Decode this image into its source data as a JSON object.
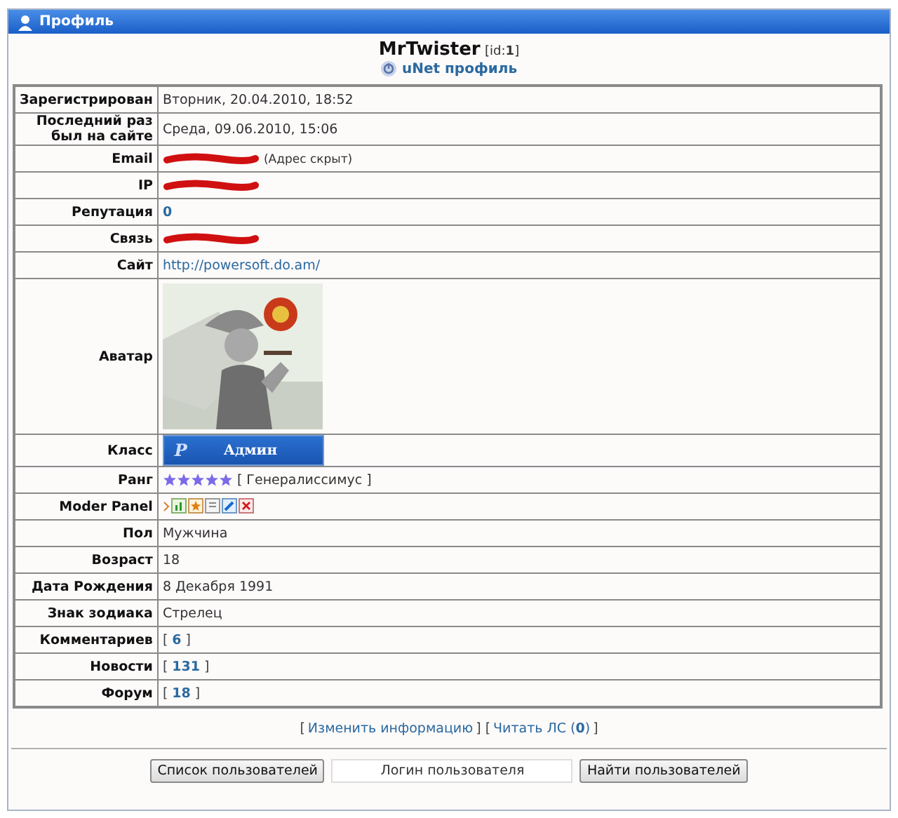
{
  "window": {
    "title": "Профиль"
  },
  "header": {
    "name": "MrTwister",
    "id_prefix": "[id:",
    "id": "1",
    "id_suffix": "]",
    "unet": "uNet профиль"
  },
  "rows": [
    {
      "kind": "text",
      "label": "Зарегистрирован",
      "value": "Вторник, 20.04.2010, 18:52"
    },
    {
      "kind": "text",
      "label": "Последний раз был на сайте",
      "value": "Среда, 09.06.2010, 15:06"
    },
    {
      "kind": "redacted",
      "label": "Email",
      "note": "(Адрес скрыт)"
    },
    {
      "kind": "redacted",
      "label": "IP"
    },
    {
      "kind": "boldlink",
      "label": "Репутация",
      "value": "0"
    },
    {
      "kind": "redacted",
      "label": "Связь"
    },
    {
      "kind": "link",
      "label": "Сайт",
      "value": "http://powersoft.do.am/"
    },
    {
      "kind": "avatar",
      "label": "Аватар"
    },
    {
      "kind": "badge",
      "label": "Класс",
      "logo": "P",
      "value": "Админ"
    },
    {
      "kind": "stars",
      "label": "Ранг",
      "stars": 5,
      "value": "[ Генералиссимус ]"
    },
    {
      "kind": "icons",
      "label": "Moder Panel",
      "icons": [
        {
          "kind": "arrow"
        },
        {
          "kind": "chart"
        },
        {
          "kind": "star"
        },
        {
          "kind": "page"
        },
        {
          "kind": "edit"
        },
        {
          "kind": "delete"
        }
      ]
    },
    {
      "kind": "text",
      "label": "Пол",
      "value": "Мужчина"
    },
    {
      "kind": "text",
      "label": "Возраст",
      "value": "18"
    },
    {
      "kind": "text",
      "label": "Дата Рождения",
      "value": "8 Декабря 1991"
    },
    {
      "kind": "text",
      "label": "Знак зодиака",
      "value": "Стрелец"
    },
    {
      "kind": "count",
      "label": "Комментариев",
      "open": "[",
      "value": "6",
      "close": "]"
    },
    {
      "kind": "count",
      "label": "Новости",
      "open": "[",
      "value": "131",
      "close": "]"
    },
    {
      "kind": "count",
      "label": "Форум",
      "open": "[",
      "value": "18",
      "close": "]"
    }
  ],
  "footer_links": [
    {
      "kind": "plain",
      "text": "["
    },
    {
      "kind": "link",
      "text": "Изменить информацию"
    },
    {
      "kind": "plain",
      "text": "] ["
    },
    {
      "kind": "link",
      "text": "Читать ЛС ("
    },
    {
      "kind": "boldlink",
      "text": "0"
    },
    {
      "kind": "link",
      "text": ")"
    },
    {
      "kind": "plain",
      "text": "]"
    }
  ],
  "search": {
    "list_button": "Список пользователей",
    "placeholder": "Логин пользователя",
    "find_button": "Найти пользователей"
  }
}
